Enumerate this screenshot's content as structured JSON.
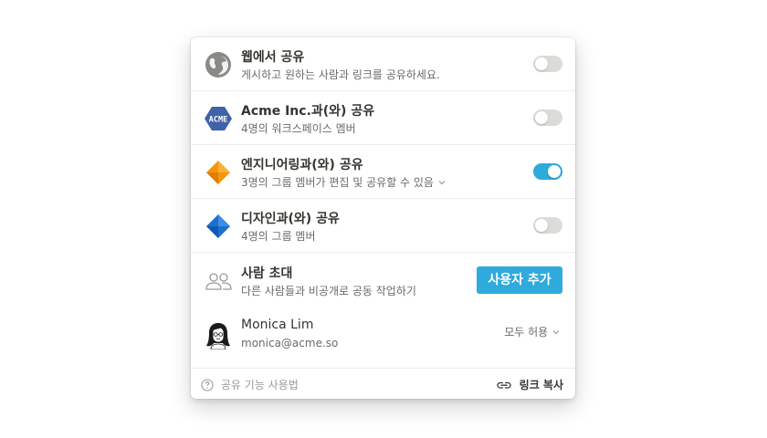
{
  "share_web": {
    "title": "웹에서 공유",
    "subtitle": "게시하고 원하는 사람과 링크를 공유하세요.",
    "icon": "globe-icon",
    "enabled": false
  },
  "share_workspace": {
    "title": "Acme Inc.과(와) 공유",
    "subtitle": "4명의 워크스페이스 멤버",
    "logo_text": "ACME",
    "icon": "acme-logo-icon",
    "enabled": false
  },
  "share_engineering": {
    "title": "엔지니어링과(와) 공유",
    "subtitle": "3명의 그룹 멤버가 편집 및 공유할 수 있음",
    "icon": "orange-diamond-icon",
    "enabled": true
  },
  "share_design": {
    "title": "디자인과(와) 공유",
    "subtitle": "4명의 그룹 멤버",
    "icon": "blue-diamond-icon",
    "enabled": false
  },
  "invite": {
    "title": "사람 초대",
    "subtitle": "다른 사람들과 비공개로 공동 작업하기",
    "button_label": "사용자 추가",
    "icon": "people-icon"
  },
  "member": {
    "name": "Monica Lim",
    "email": "monica@acme.so",
    "permission": "모두 허용",
    "icon": "avatar-icon"
  },
  "footer": {
    "help_label": "공유 기능 사용법",
    "copy_link_label": "링크 복사"
  },
  "colors": {
    "accent": "#2eaadc",
    "toggle_off": "#dcdbd8",
    "acme_blue": "#3f62a8",
    "orange": "#f5960a",
    "blue": "#1a6fd0"
  }
}
